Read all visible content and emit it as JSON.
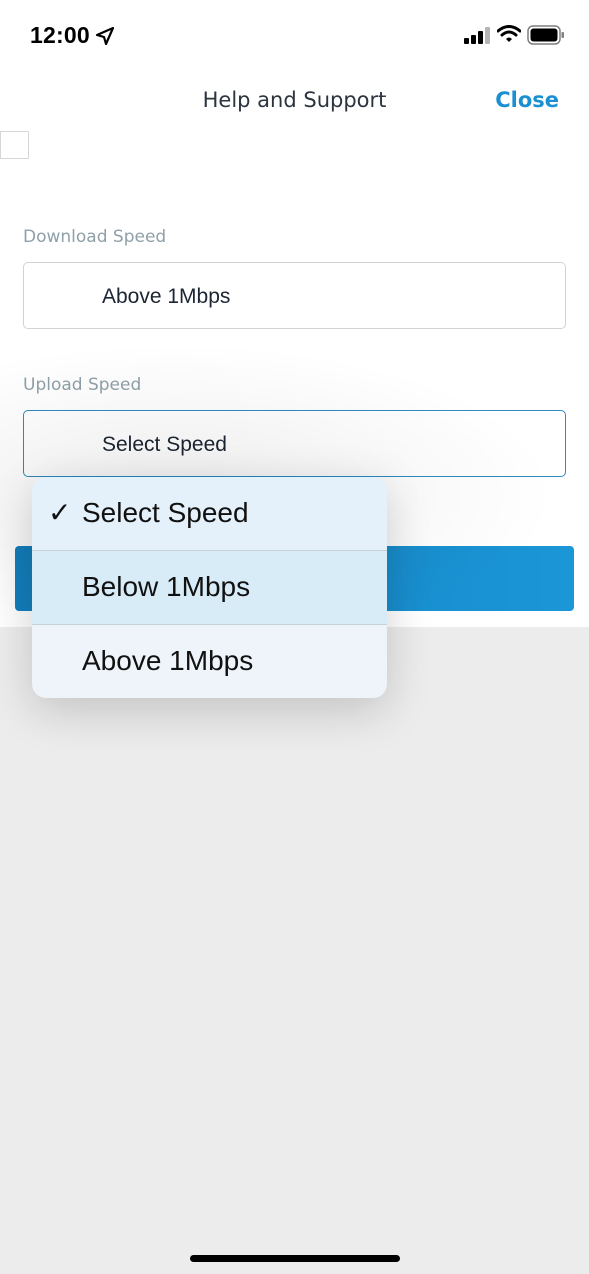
{
  "status_bar": {
    "time": "12:00",
    "icons": [
      "location-arrow-icon",
      "signal-icon",
      "wifi-icon",
      "battery-icon"
    ]
  },
  "nav": {
    "title": "Help and Support",
    "close_label": "Close"
  },
  "form": {
    "download": {
      "label": "Download Speed",
      "value": "Above 1Mbps"
    },
    "upload": {
      "label": "Upload Speed",
      "value": "Select Speed"
    }
  },
  "dropdown": {
    "check_mark": "✓",
    "options": [
      {
        "label": "Select Speed",
        "selected": true
      },
      {
        "label": "Below 1Mbps",
        "selected": false
      },
      {
        "label": "Above 1Mbps",
        "selected": false
      }
    ]
  },
  "colors": {
    "accent": "#1a8fd1",
    "button_start": "#137fbd",
    "button_end": "#1b96d7",
    "label": "#8fa0a8",
    "overlay": "#ececec"
  }
}
